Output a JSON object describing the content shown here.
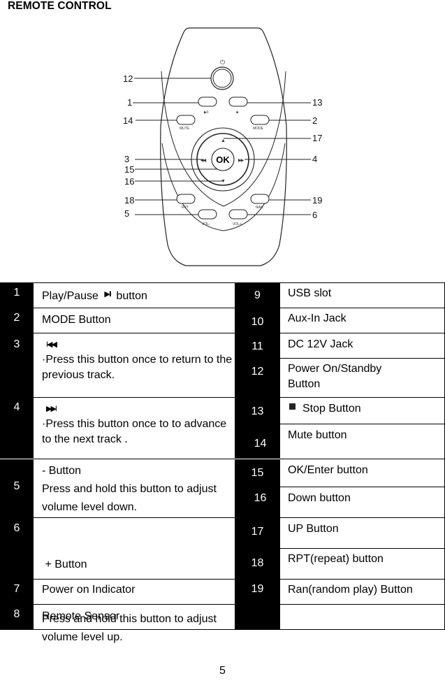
{
  "page": {
    "title": "REMOTE CONTROL",
    "page_number": "5"
  },
  "diagram": {
    "callouts": {
      "c1": "1",
      "c2": "2",
      "c3": "3",
      "c4": "4",
      "c5": "5",
      "c6": "6",
      "c12": "12",
      "c13": "13",
      "c14": "14",
      "c15": "15",
      "c16": "16",
      "c17": "17",
      "c18": "18",
      "c19": "19"
    },
    "button_labels": {
      "mute": "MUTE",
      "mode": "MODE",
      "ok": "OK",
      "rpt": "RPT",
      "ran": "RAN",
      "vol_down": "VOL-",
      "vol_up": "VOL+",
      "play_pause_glyph": "▶II",
      "stop_glyph": "■",
      "power_glyph": "⏻",
      "prev_glyph": "◀◀",
      "next_glyph": "▶▶",
      "up_glyph": "▲",
      "down_glyph": "▼"
    }
  },
  "table": {
    "left": [
      {
        "num": "1",
        "text": "Play/Pause",
        "icon": "play-pause-icon",
        "icon_glyph": "▶II",
        "suffix": "button"
      },
      {
        "num": "2",
        "text": "MODE Button"
      },
      {
        "num": "3",
        "icon": "previous-track-icon",
        "icon_glyph": "I◀◀",
        "text": "·Press this button once to return to the previous track."
      },
      {
        "num": "4",
        "icon": "next-track-icon",
        "icon_glyph": "▶▶I",
        "text": "·Press this button once to to advance to the next track ."
      },
      {
        "num": "5",
        "title": "-  Button",
        "text": "Press and hold this button to adjust volume level down."
      },
      {
        "num": "6",
        "title": " + Button",
        "text": "Press and hold this button to adjust volume level up."
      },
      {
        "num": "7",
        "text": "Power on Indicator"
      },
      {
        "num": "8",
        "text": "Remote Sensor"
      }
    ],
    "right": [
      {
        "num": "9",
        "text": "USB slot"
      },
      {
        "num": "10",
        "text": "Aux-In Jack"
      },
      {
        "num": "11",
        "text": "DC 12V Jack"
      },
      {
        "num": "12",
        "text": "Power On/Standby Button"
      },
      {
        "num": "13",
        "icon": "stop-icon",
        "text": "Stop Button"
      },
      {
        "num": "14",
        "text": "Mute button"
      },
      {
        "num": "15",
        "text": "OK/Enter button"
      },
      {
        "num": "16",
        "text": "Down button"
      },
      {
        "num": "17",
        "text": "UP Button"
      },
      {
        "num": "18",
        "text": "RPT(repeat) button"
      },
      {
        "num": "19",
        "text": "Ran(random play) Button"
      },
      {
        "num": "",
        "text": ""
      }
    ]
  }
}
